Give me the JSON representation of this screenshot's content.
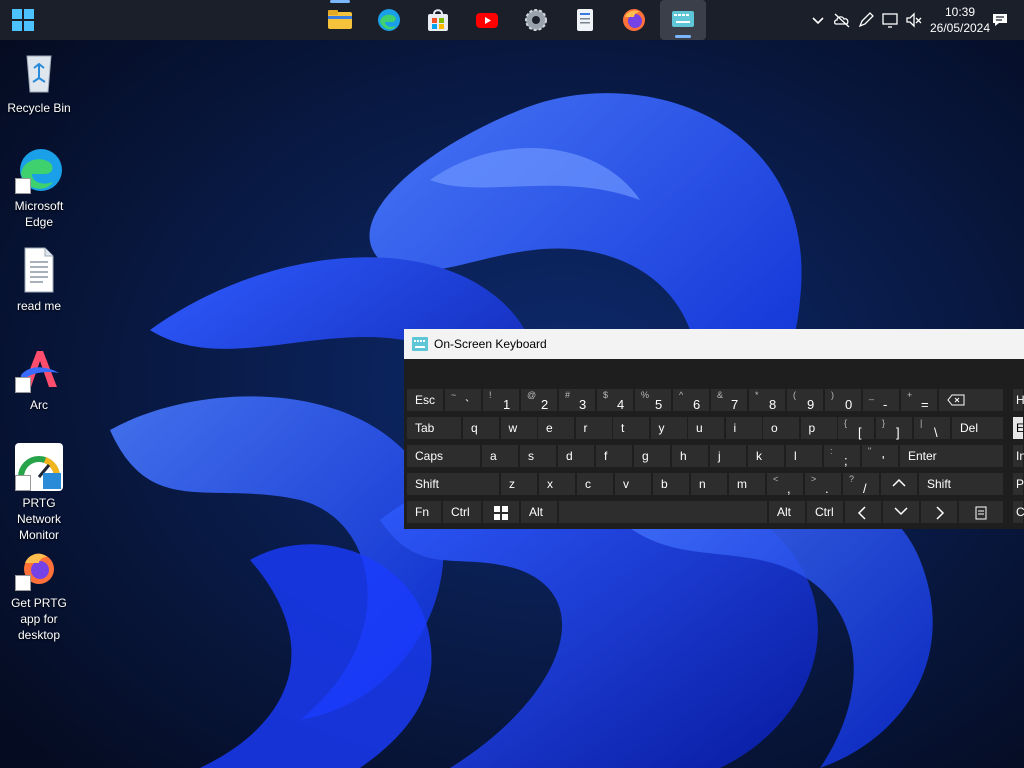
{
  "taskbar": {
    "apps": [
      {
        "name": "file-explorer-icon"
      },
      {
        "name": "edge-icon"
      },
      {
        "name": "store-icon"
      },
      {
        "name": "youtube-icon"
      },
      {
        "name": "settings-icon"
      },
      {
        "name": "notepad-icon"
      },
      {
        "name": "firefox-icon"
      },
      {
        "name": "onscreen-keyboard-icon",
        "active": true
      }
    ],
    "clock": {
      "time": "10:39",
      "date": "26/05/2024"
    }
  },
  "desktop": {
    "icons": [
      {
        "label": "Recycle Bin"
      },
      {
        "label": "Microsoft Edge"
      },
      {
        "label": "read me"
      },
      {
        "label": "Arc"
      },
      {
        "label": "PRTG Network Monitor"
      },
      {
        "label": "Get PRTG app for desktop"
      }
    ]
  },
  "osk": {
    "title": "On-Screen Keyboard",
    "row1": [
      {
        "lo": "Esc"
      },
      {
        "sh": "~",
        "ch": "`"
      },
      {
        "sh": "!",
        "ch": "1"
      },
      {
        "sh": "@",
        "ch": "2"
      },
      {
        "sh": "#",
        "ch": "3"
      },
      {
        "sh": "$",
        "ch": "4"
      },
      {
        "sh": "%",
        "ch": "5"
      },
      {
        "sh": "^",
        "ch": "6"
      },
      {
        "sh": "&",
        "ch": "7"
      },
      {
        "sh": "*",
        "ch": "8"
      },
      {
        "sh": "(",
        "ch": "9"
      },
      {
        "sh": ")",
        "ch": "0"
      },
      {
        "sh": "_",
        "ch": "-"
      },
      {
        "sh": "+",
        "ch": "="
      }
    ],
    "row2": [
      "Tab",
      "q",
      "w",
      "e",
      "r",
      "t",
      "y",
      "u",
      "i",
      "o",
      "p"
    ],
    "row2b": [
      {
        "sh": "{",
        "ch": "["
      },
      {
        "sh": "}",
        "ch": "]"
      },
      {
        "sh": "|",
        "ch": "\\"
      }
    ],
    "row2_del": "Del",
    "row3": [
      "Caps",
      "a",
      "s",
      "d",
      "f",
      "g",
      "h",
      "j",
      "k",
      "l"
    ],
    "row3b": [
      {
        "sh": ":",
        "ch": ";"
      },
      {
        "sh": "\"",
        "ch": "'"
      }
    ],
    "row3_enter": "Enter",
    "row4": [
      "Shift",
      "z",
      "x",
      "c",
      "v",
      "b",
      "n",
      "m"
    ],
    "row4b": [
      {
        "sh": "<",
        "ch": ","
      },
      {
        "sh": ">",
        "ch": "."
      },
      {
        "sh": "?",
        "ch": "/"
      }
    ],
    "row4_shift_r": "Shift",
    "row5": {
      "fn": "Fn",
      "ctrl": "Ctrl",
      "alt": "Alt",
      "alt_r": "Alt",
      "ctrl_r": "Ctrl"
    },
    "side": [
      "H",
      "E",
      "In",
      "P",
      "C"
    ]
  },
  "colors": {
    "taskbar": "#1b1f2a",
    "accent": "#7ab7ff",
    "osk_key": "#2d2d2d"
  }
}
